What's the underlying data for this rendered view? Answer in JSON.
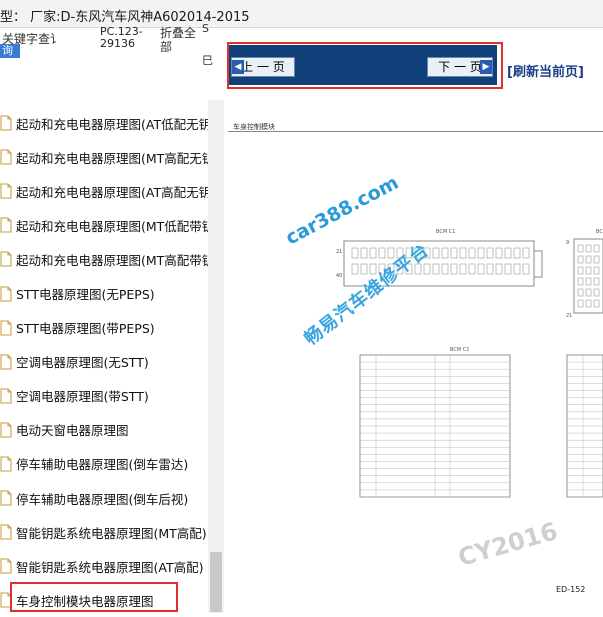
{
  "title_bar": {
    "text": "型：  厂家:D-东风汽车风神A602014-2015"
  },
  "search": {
    "keyword_label": "关键字查讠",
    "query_button": "询",
    "pc_code": "PC.123-29136",
    "fold_label": "折叠全部",
    "side_s": "S",
    "side_b": "巳"
  },
  "list": {
    "items": [
      {
        "label": "起动和充电电器原理图(AT低配无钥匙)"
      },
      {
        "label": "起动和充电电器原理图(MT高配无钥匙)"
      },
      {
        "label": "起动和充电电器原理图(AT高配无钥匙)"
      },
      {
        "label": "起动和充电电器原理图(MT低配带钥匙)"
      },
      {
        "label": "起动和充电电器原理图(MT高配带钥匙)"
      },
      {
        "label": "STT电器原理图(无PEPS)"
      },
      {
        "label": "STT电器原理图(带PEPS)"
      },
      {
        "label": "空调电器原理图(无STT)"
      },
      {
        "label": "空调电器原理图(带STT)"
      },
      {
        "label": "电动天窗电器原理图"
      },
      {
        "label": "停车辅助电器原理图(倒车雷达)"
      },
      {
        "label": "停车辅助电器原理图(倒车后视)"
      },
      {
        "label": "智能钥匙系统电器原理图(MT高配)"
      },
      {
        "label": "智能钥匙系统电器原理图(AT高配)"
      },
      {
        "label": "车身控制模块电器原理图"
      }
    ],
    "selected_index": 14
  },
  "viewer": {
    "prev_label": "上 一 页",
    "next_label": "下 一 页",
    "refresh_label": "[刷新当前页]",
    "doc_header": "车身控制模块",
    "page_number": "ED-152",
    "connector_labels": [
      "BCM C1",
      "BCM C1",
      "BC"
    ],
    "watermark_url": "car388.com",
    "watermark_cn": "畅易汽车维修平台",
    "watermark_gray": "CY2016"
  },
  "colors": {
    "nav_bg": "#10407a",
    "highlight_red": "#e03030",
    "refresh_text": "#1a3f8a",
    "watermark_blue": "#2a9ad9"
  }
}
